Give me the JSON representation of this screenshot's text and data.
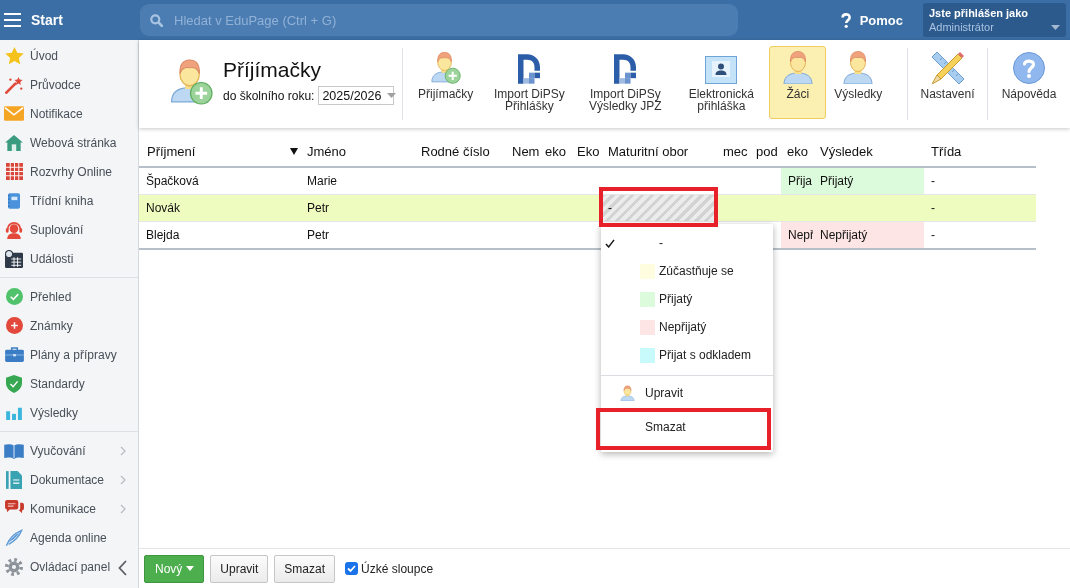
{
  "topbar": {
    "menu_label": "Start",
    "search": {
      "placeholder": "Hledat v EduPage (Ctrl + G)"
    },
    "help_label": "Pomoc",
    "user": {
      "caption": "Jste přihlášen jako",
      "name": "Administrátor"
    }
  },
  "sidebar": {
    "groups": [
      {
        "items": [
          {
            "label": "Úvod",
            "submenu": false
          },
          {
            "label": "Průvodce",
            "submenu": false
          },
          {
            "label": "Notifikace",
            "submenu": false
          },
          {
            "label": "Webová stránka",
            "submenu": false
          },
          {
            "label": "Rozvrhy Online",
            "submenu": false
          },
          {
            "label": "Třídní kniha",
            "submenu": false
          },
          {
            "label": "Suplování",
            "submenu": false
          },
          {
            "label": "Události",
            "submenu": false
          }
        ]
      },
      {
        "items": [
          {
            "label": "Přehled",
            "submenu": false
          },
          {
            "label": "Známky",
            "submenu": false
          },
          {
            "label": "Plány a přípravy",
            "submenu": false
          },
          {
            "label": "Standardy",
            "submenu": false
          },
          {
            "label": "Výsledky",
            "submenu": false
          }
        ]
      },
      {
        "items": [
          {
            "label": "Vyučování",
            "submenu": true
          },
          {
            "label": "Dokumentace",
            "submenu": true
          },
          {
            "label": "Komunikace",
            "submenu": true
          },
          {
            "label": "Agenda online",
            "submenu": false
          },
          {
            "label": "Ovládací panel",
            "submenu": false
          }
        ]
      }
    ]
  },
  "header": {
    "title": "Příjímačky",
    "year_label": "do školního roku:",
    "year_value": "2025/2026"
  },
  "toolbar": {
    "groups": [
      {
        "items": [
          {
            "label": "Přijímačky",
            "selected": false
          },
          {
            "label": "Import DiPSy Přihlášky",
            "selected": false
          },
          {
            "label": "Import DiPSy Výsledky JPZ",
            "selected": false
          },
          {
            "label": "Elektronická přihláška",
            "selected": false
          },
          {
            "label": "Žáci",
            "selected": true
          },
          {
            "label": "Výsledky",
            "selected": false
          }
        ]
      },
      {
        "items": [
          {
            "label": "Nastavení",
            "selected": false
          }
        ]
      },
      {
        "items": [
          {
            "label": "Nápověda",
            "selected": false
          }
        ]
      }
    ]
  },
  "table": {
    "columns": [
      {
        "label": "Příjmení",
        "sorted": true
      },
      {
        "label": "Jméno",
        "sorted": false
      },
      {
        "label": "Rodné číslo",
        "sorted": false
      },
      {
        "label": "Nem",
        "sorted": false
      },
      {
        "label": "eko",
        "sorted": false
      },
      {
        "label": "Eko",
        "sorted": false
      },
      {
        "label": "Maturitní obor",
        "sorted": false
      },
      {
        "label": "mec",
        "sorted": false
      },
      {
        "label": "pod",
        "sorted": false
      },
      {
        "label": "eko",
        "sorted": false
      },
      {
        "label": "Výsledek",
        "sorted": false
      },
      {
        "label": "Třída",
        "sorted": false
      }
    ],
    "rows": [
      {
        "selected": false,
        "surname": "Špačková",
        "first_name": "Marie",
        "column_10": {
          "text": "Přija",
          "color": "#dcfadc"
        },
        "result": {
          "text": "Přijatý",
          "color": "#dcfadc"
        },
        "class": "-"
      },
      {
        "selected": true,
        "surname": "Novák",
        "first_name": "Petr",
        "maturity_field": {
          "text": "-",
          "active": true,
          "highlighted": true
        },
        "class": "-"
      },
      {
        "selected": false,
        "surname": "Blejda",
        "first_name": "Petr",
        "column_10": {
          "text": "Nepř",
          "color": "#fde5e5"
        },
        "result": {
          "text": "Nepřijatý",
          "color": "#fde5e5"
        },
        "class": "-"
      }
    ]
  },
  "status_menu": {
    "items": [
      {
        "kind": "option",
        "label": "-",
        "selected": true,
        "highlighted": false
      },
      {
        "kind": "option",
        "label": "Zúčastňuje se",
        "color": "#fffde0",
        "selected": false,
        "highlighted": false
      },
      {
        "kind": "option",
        "label": "Přijatý",
        "color": "#dcfadc",
        "selected": false,
        "highlighted": false
      },
      {
        "kind": "option",
        "label": "Nepřijatý",
        "color": "#fde5e5",
        "selected": false,
        "highlighted": false
      },
      {
        "kind": "option",
        "label": "Přijat s odkladem",
        "color": "#c8fafb",
        "selected": false,
        "highlighted": false
      },
      {
        "kind": "action",
        "label": "Upravit",
        "highlighted": false
      },
      {
        "kind": "command",
        "label": "Smazat",
        "highlighted": true
      }
    ]
  },
  "footer": {
    "buttons": [
      {
        "label": "Nový",
        "kind": "primary"
      },
      {
        "label": "Upravit",
        "kind": "plain"
      },
      {
        "label": "Smazat",
        "kind": "plain"
      }
    ],
    "narrow_columns": {
      "label": "Úzké sloupce",
      "checked": true
    }
  }
}
